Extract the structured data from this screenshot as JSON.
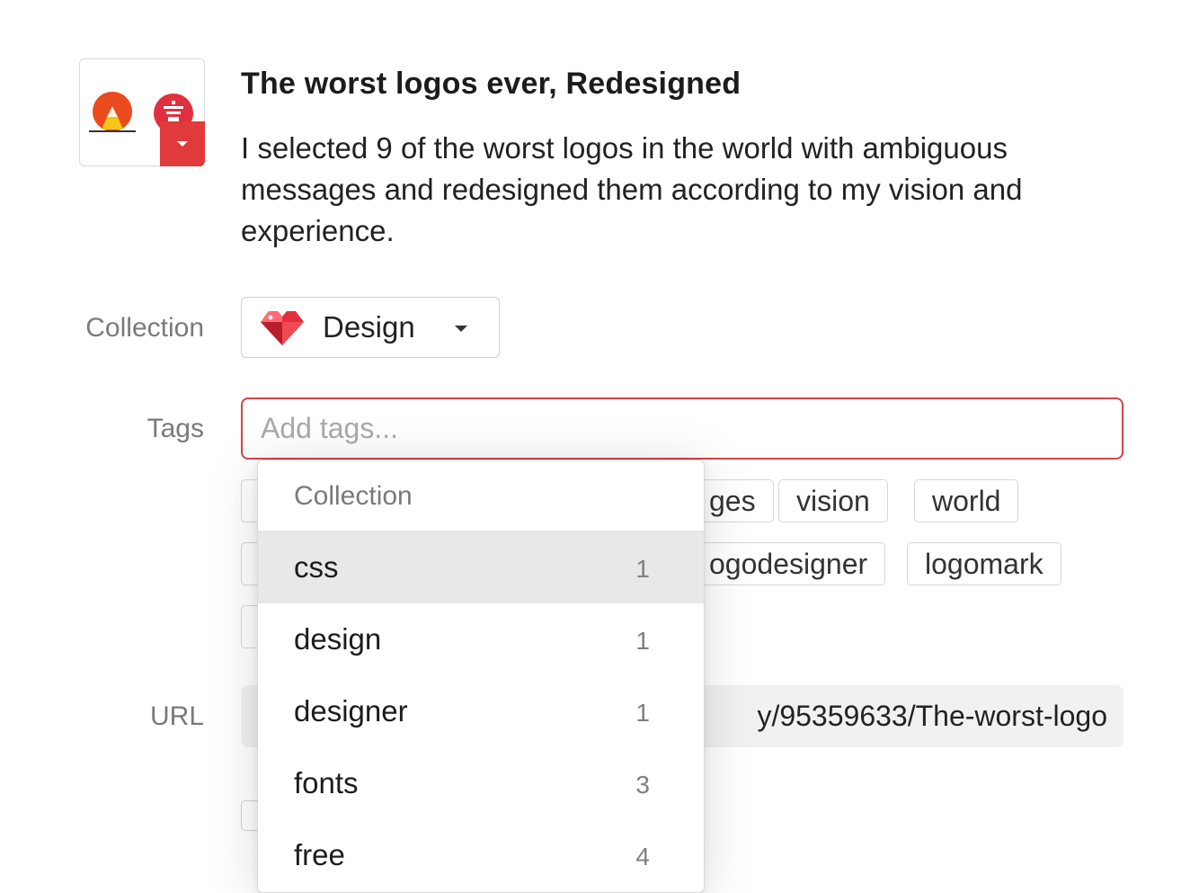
{
  "item": {
    "title": "The worst logos ever, Redesigned",
    "description": "I selected 9 of the worst logos in the world with ambiguous messages and redesigned them according to my vision and experience."
  },
  "labels": {
    "collection": "Collection",
    "tags": "Tags",
    "url": "URL"
  },
  "collection_select": {
    "icon": "red-heart-gem-icon",
    "value": "Design"
  },
  "tags_input": {
    "placeholder": "Add tags..."
  },
  "suggested_tags": {
    "row1": [
      "ges",
      "vision",
      "world"
    ],
    "row2": [
      "ogodesigner",
      "logomark"
    ]
  },
  "url_field": {
    "value_visible": "y/95359633/The-worst-logo"
  },
  "dropdown": {
    "header": "Collection",
    "items": [
      {
        "name": "css",
        "count": "1"
      },
      {
        "name": "design",
        "count": "1"
      },
      {
        "name": "designer",
        "count": "1"
      },
      {
        "name": "fonts",
        "count": "3"
      },
      {
        "name": "free",
        "count": "4"
      }
    ]
  },
  "colors": {
    "accent_red": "#e03a3a",
    "focus_border": "#d64545",
    "highlight_row": "#e8e8e8"
  }
}
